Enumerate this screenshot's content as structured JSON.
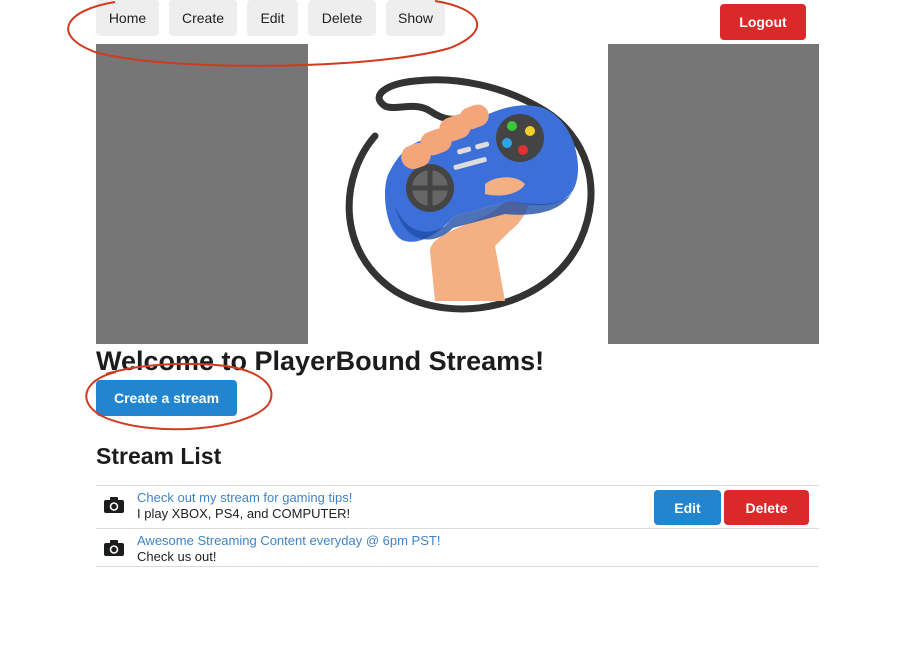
{
  "nav": {
    "home_label": "Home",
    "create_label": "Create",
    "edit_label": "Edit",
    "delete_label": "Delete",
    "show_label": "Show",
    "logout_label": "Logout"
  },
  "main": {
    "title": "Welcome to PlayerBound Streams!",
    "create_stream_label": "Create a stream",
    "list_title": "Stream List"
  },
  "streams": [
    {
      "title": "Check out my stream for gaming tips!",
      "description": "I play XBOX, PS4, and COMPUTER!",
      "icon": "camera-icon",
      "edit_label": "Edit",
      "delete_label": "Delete"
    },
    {
      "title": "Awesome Streaming Content everyday @ 6pm PST!",
      "description": "Check us out!",
      "icon": "camera-icon"
    }
  ],
  "colors": {
    "primary": "#2185d0",
    "danger": "#db2828",
    "link": "#4183c4",
    "annotation": "#d03b1f"
  }
}
